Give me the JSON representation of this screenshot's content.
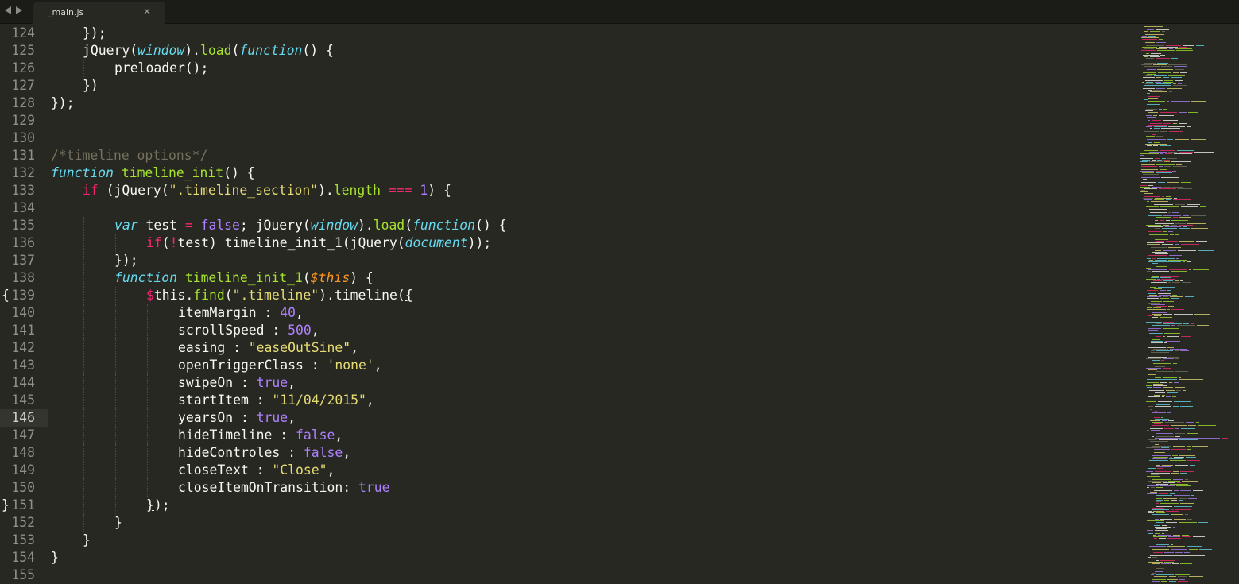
{
  "window": {
    "tab": {
      "title": "_main.js",
      "close_glyph": "×"
    },
    "nav": {
      "back_glyph": "◀",
      "forward_glyph": "▶"
    }
  },
  "editor": {
    "current_line": 146,
    "lines": [
      {
        "n": "124",
        "fold": "",
        "indent": 1,
        "tokens": [
          [
            "",
            "});"
          ]
        ]
      },
      {
        "n": "125",
        "fold": "",
        "indent": 1,
        "tokens": [
          [
            "",
            "jQuery("
          ],
          [
            "i",
            "window"
          ],
          [
            "",
            ")."
          ],
          [
            "f",
            "load"
          ],
          [
            "",
            "("
          ],
          [
            "i",
            "function"
          ],
          [
            "",
            "() {"
          ]
        ]
      },
      {
        "n": "126",
        "fold": "",
        "indent": 2,
        "tokens": [
          [
            "",
            "preloader();"
          ]
        ]
      },
      {
        "n": "127",
        "fold": "",
        "indent": 1,
        "tokens": [
          [
            "",
            "})"
          ]
        ]
      },
      {
        "n": "128",
        "fold": "",
        "indent": 0,
        "tokens": [
          [
            "",
            "});"
          ]
        ]
      },
      {
        "n": "129",
        "fold": "",
        "indent": 0,
        "tokens": []
      },
      {
        "n": "130",
        "fold": "",
        "indent": 0,
        "tokens": []
      },
      {
        "n": "131",
        "fold": "",
        "indent": 0,
        "tokens": [
          [
            "c",
            "/*timeline options*/"
          ]
        ]
      },
      {
        "n": "132",
        "fold": "",
        "indent": 0,
        "tokens": [
          [
            "i",
            "function"
          ],
          [
            "",
            " "
          ],
          [
            "f",
            "timeline_init"
          ],
          [
            "",
            "() {"
          ]
        ]
      },
      {
        "n": "133",
        "fold": "",
        "indent": 1,
        "tokens": [
          [
            "k",
            "if"
          ],
          [
            "",
            " (jQuery("
          ],
          [
            "s",
            "\".timeline_section\""
          ],
          [
            "",
            ")."
          ],
          [
            "f",
            "length"
          ],
          [
            "",
            " "
          ],
          [
            "k",
            "==="
          ],
          [
            "",
            " "
          ],
          [
            "n",
            "1"
          ],
          [
            "",
            ") {"
          ]
        ]
      },
      {
        "n": "134",
        "fold": "",
        "indent": 0,
        "tokens": []
      },
      {
        "n": "135",
        "fold": "",
        "indent": 2,
        "tokens": [
          [
            "i",
            "var"
          ],
          [
            "",
            " test "
          ],
          [
            "k",
            "="
          ],
          [
            "",
            " "
          ],
          [
            "n",
            "false"
          ],
          [
            "",
            "; jQuery("
          ],
          [
            "i",
            "window"
          ],
          [
            "",
            ")."
          ],
          [
            "f",
            "load"
          ],
          [
            "",
            "("
          ],
          [
            "i",
            "function"
          ],
          [
            "",
            "() {"
          ]
        ]
      },
      {
        "n": "136",
        "fold": "",
        "indent": 3,
        "tokens": [
          [
            "k",
            "if"
          ],
          [
            "",
            "("
          ],
          [
            "k",
            "!"
          ],
          [
            "",
            "test) timeline_init_1(jQuery("
          ],
          [
            "i",
            "document"
          ],
          [
            "",
            "));"
          ]
        ]
      },
      {
        "n": "137",
        "fold": "",
        "indent": 2,
        "tokens": [
          [
            "",
            "});"
          ]
        ]
      },
      {
        "n": "138",
        "fold": "",
        "indent": 2,
        "tokens": [
          [
            "i",
            "function"
          ],
          [
            "",
            " "
          ],
          [
            "f",
            "timeline_init_1"
          ],
          [
            "",
            "("
          ],
          [
            "p",
            "$this"
          ],
          [
            "",
            ") {"
          ]
        ]
      },
      {
        "n": "139",
        "fold": "{",
        "indent": 3,
        "tokens": [
          [
            "k",
            "$"
          ],
          [
            "",
            "this."
          ],
          [
            "f",
            "find"
          ],
          [
            "",
            "("
          ],
          [
            "s",
            "\".timeline\""
          ],
          [
            "",
            ").timeline("
          ],
          [
            "ul",
            "{"
          ]
        ]
      },
      {
        "n": "140",
        "fold": "",
        "indent": 4,
        "tokens": [
          [
            "",
            "itemMargin : "
          ],
          [
            "n",
            "40"
          ],
          [
            "",
            ","
          ]
        ]
      },
      {
        "n": "141",
        "fold": "",
        "indent": 4,
        "tokens": [
          [
            "",
            "scrollSpeed : "
          ],
          [
            "n",
            "500"
          ],
          [
            "",
            ","
          ]
        ]
      },
      {
        "n": "142",
        "fold": "",
        "indent": 4,
        "tokens": [
          [
            "",
            "easing : "
          ],
          [
            "s",
            "\"easeOutSine\""
          ],
          [
            "",
            ","
          ]
        ]
      },
      {
        "n": "143",
        "fold": "",
        "indent": 4,
        "tokens": [
          [
            "",
            "openTriggerClass : "
          ],
          [
            "s",
            "'none'"
          ],
          [
            "",
            ","
          ]
        ]
      },
      {
        "n": "144",
        "fold": "",
        "indent": 4,
        "tokens": [
          [
            "",
            "swipeOn : "
          ],
          [
            "n",
            "true"
          ],
          [
            "",
            ","
          ]
        ]
      },
      {
        "n": "145",
        "fold": "",
        "indent": 4,
        "tokens": [
          [
            "",
            "startItem : "
          ],
          [
            "s",
            "\"11/04/2015\""
          ],
          [
            "",
            ","
          ]
        ]
      },
      {
        "n": "146",
        "fold": "",
        "indent": 4,
        "tokens": [
          [
            "",
            "yearsOn : "
          ],
          [
            "n",
            "true"
          ],
          [
            "",
            ", "
          ]
        ],
        "caret": true
      },
      {
        "n": "147",
        "fold": "",
        "indent": 4,
        "tokens": [
          [
            "",
            "hideTimeline : "
          ],
          [
            "n",
            "false"
          ],
          [
            "",
            ","
          ]
        ]
      },
      {
        "n": "148",
        "fold": "",
        "indent": 4,
        "tokens": [
          [
            "",
            "hideControles : "
          ],
          [
            "n",
            "false"
          ],
          [
            "",
            ","
          ]
        ]
      },
      {
        "n": "149",
        "fold": "",
        "indent": 4,
        "tokens": [
          [
            "",
            "closeText : "
          ],
          [
            "s",
            "\"Close\""
          ],
          [
            "",
            ","
          ]
        ]
      },
      {
        "n": "150",
        "fold": "",
        "indent": 4,
        "tokens": [
          [
            "",
            "closeItemOnTransition: "
          ],
          [
            "n",
            "true"
          ]
        ]
      },
      {
        "n": "151",
        "fold": "}",
        "indent": 3,
        "tokens": [
          [
            "ul",
            "}"
          ],
          [
            "",
            ");"
          ]
        ]
      },
      {
        "n": "152",
        "fold": "",
        "indent": 2,
        "tokens": [
          [
            "",
            "}"
          ]
        ]
      },
      {
        "n": "153",
        "fold": "",
        "indent": 1,
        "tokens": [
          [
            "",
            "}"
          ]
        ]
      },
      {
        "n": "154",
        "fold": "",
        "indent": 0,
        "tokens": [
          [
            "",
            "}"
          ]
        ]
      },
      {
        "n": "155",
        "fold": "",
        "indent": 0,
        "tokens": []
      }
    ]
  },
  "colors": {
    "background": "#272822",
    "keyword": "#f92672",
    "string": "#e6db74",
    "number": "#ae81ff",
    "function": "#a6e22e",
    "storage": "#66d9ef",
    "parameter": "#fd971f",
    "comment": "#75715e"
  }
}
